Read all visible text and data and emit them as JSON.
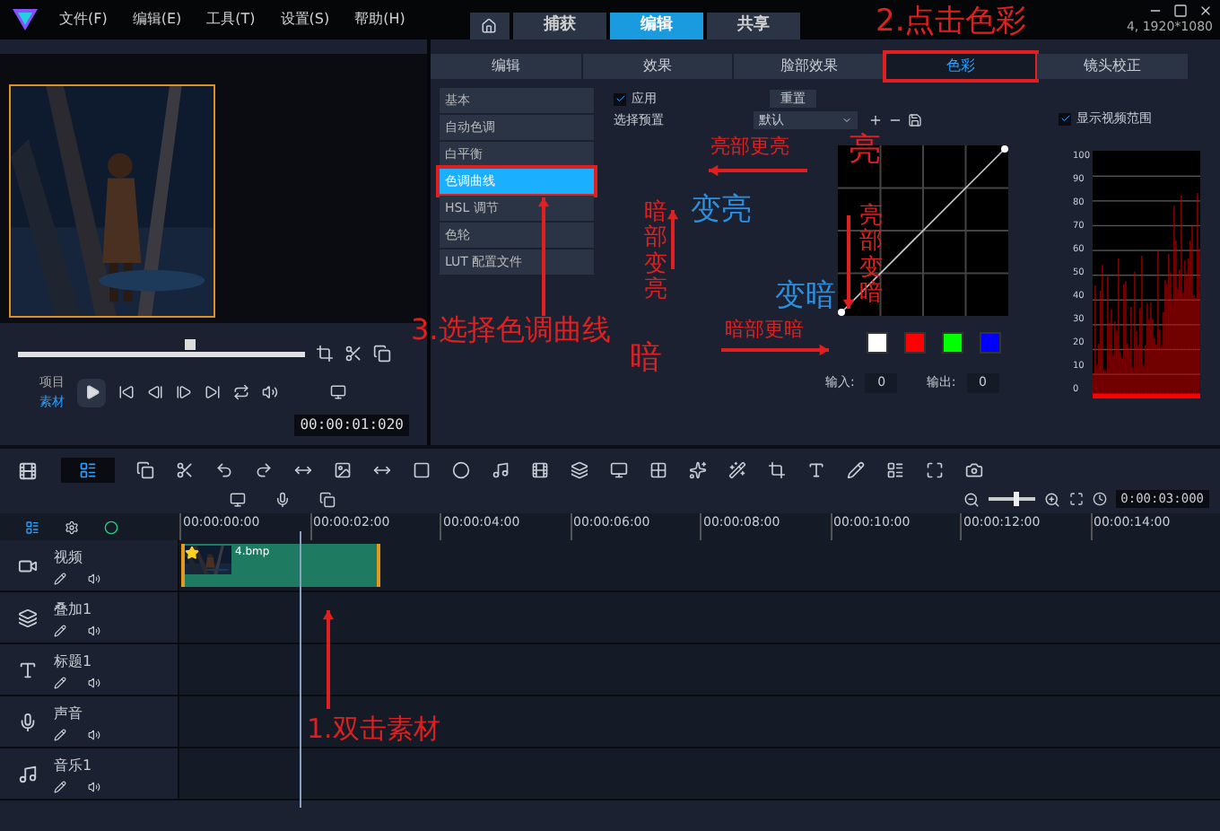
{
  "menu": [
    {
      "label": "文件(F)"
    },
    {
      "label": "编辑(E)"
    },
    {
      "label": "工具(T)"
    },
    {
      "label": "设置(S)"
    },
    {
      "label": "帮助(H)"
    }
  ],
  "workspace_tabs": [
    {
      "label": "捕获",
      "selected": false
    },
    {
      "label": "编辑",
      "selected": true
    },
    {
      "label": "共享",
      "selected": false
    }
  ],
  "project_info": "4, 1920*1080",
  "preview": {
    "scrub": {
      "level": 0.6
    },
    "modes": [
      {
        "label": "项目",
        "selected": false
      },
      {
        "label": "素材",
        "selected": true
      }
    ],
    "timecode": "00:00:01:020"
  },
  "effect_tabs": [
    {
      "label": "编辑",
      "selected": false,
      "highlighted": false
    },
    {
      "label": "效果",
      "selected": false,
      "highlighted": false
    },
    {
      "label": "脸部效果",
      "selected": false,
      "highlighted": false
    },
    {
      "label": "色彩",
      "selected": true,
      "highlighted": true
    },
    {
      "label": "镜头校正",
      "selected": false,
      "highlighted": false
    }
  ],
  "color_list": [
    {
      "label": "基本",
      "selected": false,
      "highlighted": false
    },
    {
      "label": "自动色调",
      "selected": false,
      "highlighted": false
    },
    {
      "label": "白平衡",
      "selected": false,
      "highlighted": false
    },
    {
      "label": "色调曲线",
      "selected": true,
      "highlighted": true
    },
    {
      "label": "HSL 调节",
      "selected": false,
      "highlighted": false
    },
    {
      "label": "色轮",
      "selected": false,
      "highlighted": false
    },
    {
      "label": "LUT 配置文件",
      "selected": false,
      "highlighted": false
    }
  ],
  "apply": {
    "label": "应用",
    "checked": true
  },
  "reset_button": "重置",
  "preset": {
    "label": "选择预置",
    "value": "默认"
  },
  "swatches": [
    {
      "color": "#ffffff"
    },
    {
      "color": "#ff0000"
    },
    {
      "color": "#00ff00"
    },
    {
      "color": "#0000ff"
    }
  ],
  "input": {
    "label": "输入:",
    "value": "0"
  },
  "output": {
    "label": "输出:",
    "value": "0"
  },
  "scope": {
    "label": "显示视频范围",
    "checked": true,
    "ticks": [
      "100",
      "90",
      "80",
      "70",
      "60",
      "50",
      "40",
      "30",
      "20",
      "10",
      "0"
    ]
  },
  "timeline": {
    "zoom": {
      "level": 0.6
    },
    "zoom_timecode": "0:00:03:000",
    "ruler": [
      "00:00:00:00",
      "00:00:02:00",
      "00:00:04:00",
      "00:00:06:00",
      "00:00:08:00",
      "00:00:10:00",
      "00:00:12:00",
      "00:00:14:00"
    ],
    "tracks": [
      {
        "name": "视频",
        "kind": "video"
      },
      {
        "name": "叠加1",
        "kind": "overlay"
      },
      {
        "name": "标题1",
        "kind": "title"
      },
      {
        "name": "声音",
        "kind": "voice"
      },
      {
        "name": "音乐1",
        "kind": "music"
      }
    ],
    "clip": {
      "label": "4.bmp"
    }
  },
  "annotations": [
    {
      "text": "2.点击色彩",
      "color": "#e02020"
    },
    {
      "text": "3.选择色调曲线",
      "color": "#e02020"
    },
    {
      "text": "亮部更亮",
      "color": "#e02020"
    },
    {
      "text": "亮",
      "color": "#e02020"
    },
    {
      "text": "暗部变亮",
      "color": "#e02020"
    },
    {
      "text": "变亮",
      "color": "#2a8fe0"
    },
    {
      "text": "变暗",
      "color": "#2a8fe0"
    },
    {
      "text": "亮部变暗",
      "color": "#e02020"
    },
    {
      "text": "暗部更暗",
      "color": "#e02020"
    },
    {
      "text": "暗",
      "color": "#e02020"
    },
    {
      "text": "1.双击素材",
      "color": "#e02020"
    }
  ]
}
